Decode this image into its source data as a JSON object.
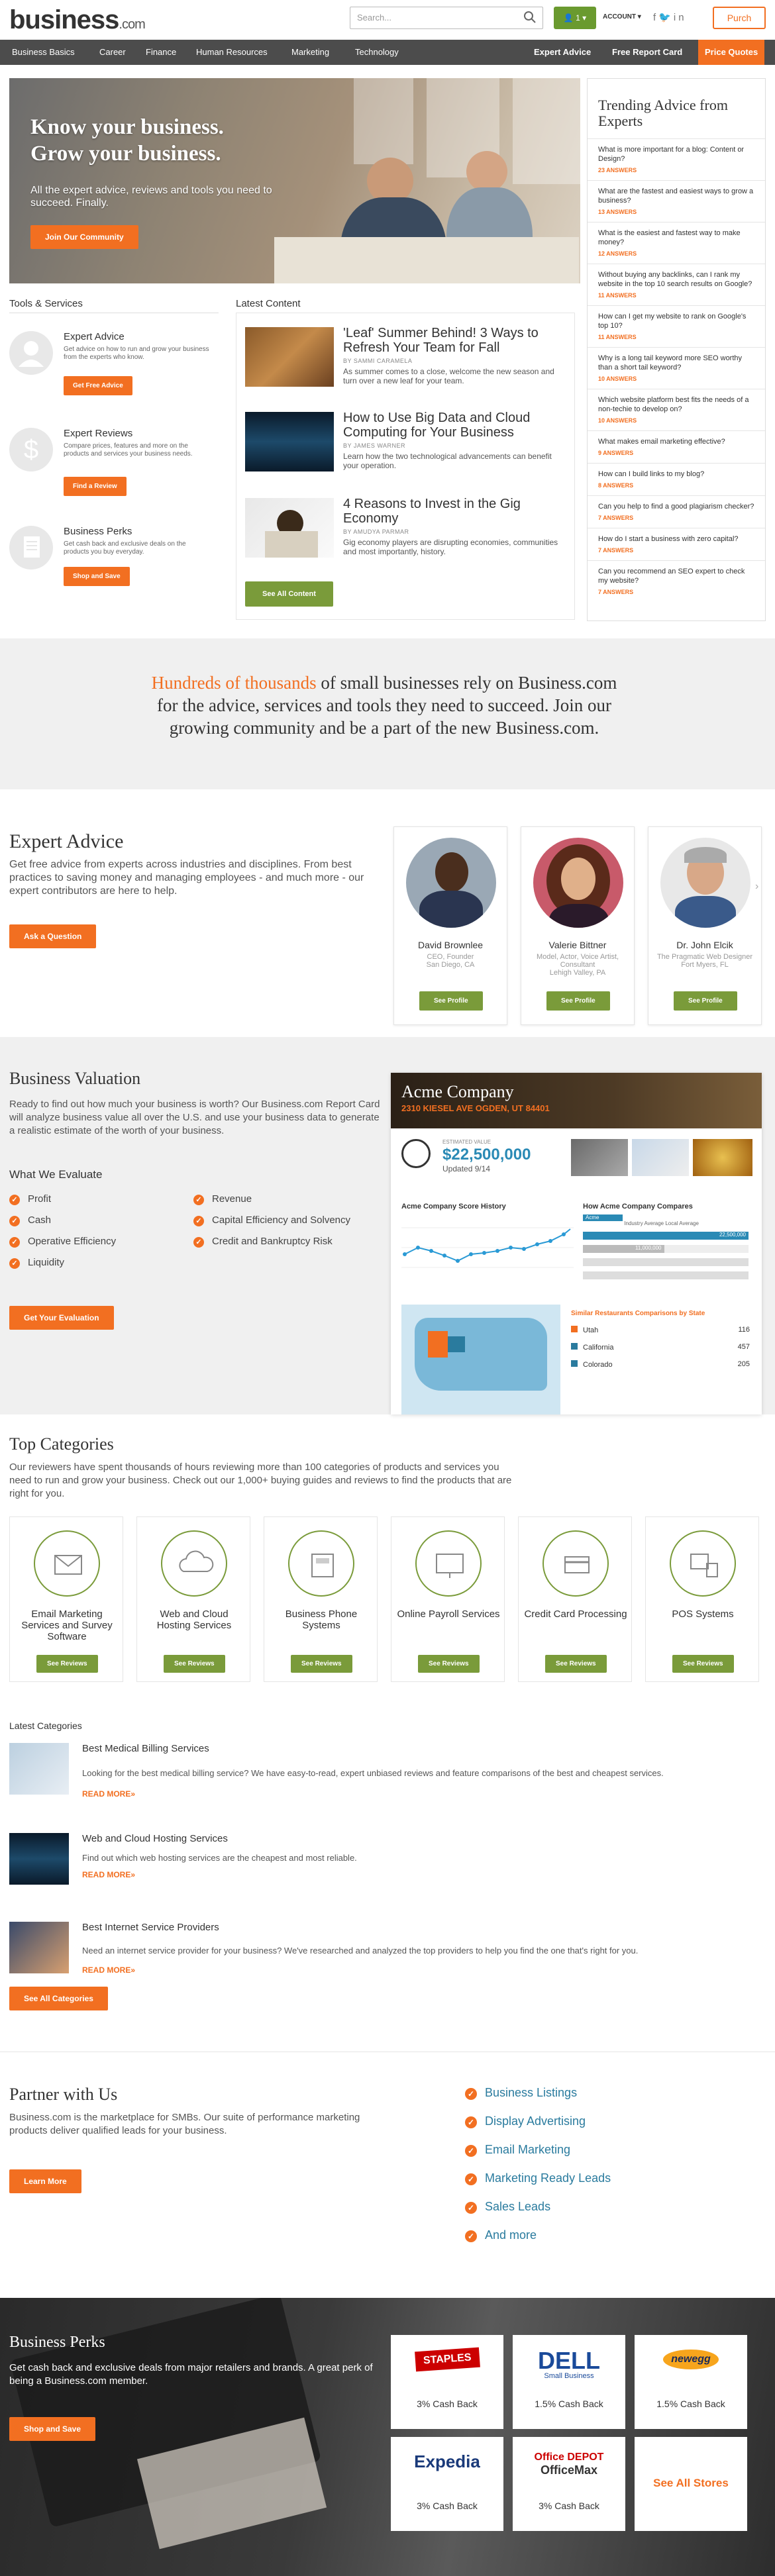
{
  "header": {
    "logo": "business",
    "logo_suffix": ".com",
    "search_placeholder": "Search...",
    "account_badge": "1",
    "account_label": "ACCOUNT",
    "purchase_label": "Purch"
  },
  "nav": {
    "left": [
      "Business Basics",
      "Career",
      "Finance",
      "Human Resources",
      "Marketing",
      "Technology"
    ],
    "right": [
      "Expert Advice",
      "Free Report Card",
      "Price Quotes"
    ]
  },
  "hero": {
    "title_l1": "Know your business.",
    "title_l2": "Grow your business.",
    "subtitle": "All the expert advice, reviews and tools you need to succeed. Finally.",
    "cta": "Join Our Community"
  },
  "trending": {
    "title": "Trending Advice from Experts",
    "items": [
      {
        "q": "What is more important for a blog: Content or Design?",
        "a": "23 ANSWERS"
      },
      {
        "q": "What are the fastest and easiest ways to grow a business?",
        "a": "13 ANSWERS"
      },
      {
        "q": "What is the easiest and fastest way to make money?",
        "a": "12 ANSWERS"
      },
      {
        "q": "Without buying any backlinks, can I rank my website in the top 10 search results on Google?",
        "a": "11 ANSWERS"
      },
      {
        "q": "How can I get my website to rank on Google's top 10?",
        "a": "11 ANSWERS"
      },
      {
        "q": "Why is a long tail keyword more SEO worthy than a short tail keyword?",
        "a": "10 ANSWERS"
      },
      {
        "q": "Which website platform best fits the needs of a non-techie to develop on?",
        "a": "10 ANSWERS"
      },
      {
        "q": "What makes email marketing effective?",
        "a": "9 ANSWERS"
      },
      {
        "q": "How can I build links to my blog?",
        "a": "8 ANSWERS"
      },
      {
        "q": "Can you help to find a good plagiarism checker?",
        "a": "7 ANSWERS"
      },
      {
        "q": "How do I start a business with zero capital?",
        "a": "7 ANSWERS"
      },
      {
        "q": "Can you recommend an SEO expert to check my website?",
        "a": "7 ANSWERS"
      }
    ]
  },
  "tools": {
    "title": "Tools & Services",
    "items": [
      {
        "t": "Expert Advice",
        "d": "Get advice on how to run and grow your business from the experts who know.",
        "b": "Get Free Advice"
      },
      {
        "t": "Expert Reviews",
        "d": "Compare prices, features and more on the products and services your business needs.",
        "b": "Find a Review"
      },
      {
        "t": "Business Perks",
        "d": "Get cash back and exclusive deals on the products you buy everyday.",
        "b": "Shop and Save"
      }
    ]
  },
  "latest": {
    "title": "Latest Content",
    "button": "See All Content",
    "items": [
      {
        "t": "'Leaf' Summer Behind! 3 Ways to Refresh Your Team for Fall",
        "by": "BY SAMMI CARAMELA",
        "d": "As summer comes to a close, welcome the new season and turn over a new leaf for your team."
      },
      {
        "t": "How to Use Big Data and Cloud Computing for Your Business",
        "by": "BY JAMES WARNER",
        "d": "Learn how the two technological advancements can benefit your operation."
      },
      {
        "t": "4 Reasons to Invest in the Gig Economy",
        "by": "BY AMUDYA PARMAR",
        "d": "Gig economy players are disrupting economies, communities and most importantly, history."
      }
    ]
  },
  "band": {
    "highlight": "Hundreds of thousands",
    "rest": " of small businesses rely on Business.com for the advice, services and tools they need to succeed. Join our growing community and be a part of the new Business.com."
  },
  "expert": {
    "title": "Expert Advice",
    "text": "Get free advice from experts across industries and disciplines. From best practices to saving money and managing employees - and much more - our expert contributors are here to help.",
    "cta": "Ask a Question",
    "people": [
      {
        "n": "David Brownlee",
        "r": "CEO, Founder\nSan Diego, CA",
        "b": "See Profile"
      },
      {
        "n": "Valerie Bittner",
        "r": "Model, Actor, Voice Artist, Consultant\nLehigh Valley, PA",
        "b": "See Profile"
      },
      {
        "n": "Dr. John Elcik",
        "r": "The Pragmatic Web Designer\nFort Myers, FL",
        "b": "See Profile"
      }
    ]
  },
  "valuation": {
    "title": "Business Valuation",
    "text": "Ready to find out how much your business is worth? Our Business.com Report Card will analyze business value all over the U.S. and use your business data to generate a realistic estimate of the worth of your business.",
    "sub": "What We Evaluate",
    "left": [
      "Profit",
      "Cash",
      "Operative Efficiency",
      "Liquidity"
    ],
    "right": [
      "Revenue",
      "Capital Efficiency and Solvency",
      "Credit and Bankruptcy Risk"
    ],
    "cta": "Get Your Evaluation",
    "dash": {
      "company": "Acme Company",
      "address": "2310 KIESEL AVE OGDEN, UT 84401",
      "est_label": "ESTIMATED VALUE",
      "value": "$22,500,000",
      "updated": "Updated 9/14",
      "hist_title": "Acme Company Score History",
      "compare_title": "How Acme Company Compares",
      "legend": [
        "Acme Company",
        "Industry Average",
        "Local Average"
      ],
      "bar_values": [
        "22,500,000",
        "11,000,000"
      ],
      "state_title": "Similar Restaurants Comparisons by State",
      "states": [
        {
          "n": "Utah",
          "v": "116"
        },
        {
          "n": "California",
          "v": "457"
        },
        {
          "n": "Colorado",
          "v": "205"
        }
      ]
    }
  },
  "categories": {
    "title": "Top Categories",
    "text": "Our reviewers have spent thousands of hours reviewing more than 100 categories of products and services you need to run and grow your business. Check out our 1,000+ buying guides and reviews to find the products that are right for you.",
    "items": [
      {
        "n": "Email Marketing Services and Survey Software",
        "b": "See Reviews",
        "icon": "envelope-icon"
      },
      {
        "n": "Web and Cloud Hosting Services",
        "b": "See Reviews",
        "icon": "cloud-icon"
      },
      {
        "n": "Business Phone Systems",
        "b": "See Reviews",
        "icon": "phone-icon"
      },
      {
        "n": "Online Payroll Services",
        "b": "See Reviews",
        "icon": "monitor-icon"
      },
      {
        "n": "Credit Card Processing",
        "b": "See Reviews",
        "icon": "card-icon"
      },
      {
        "n": "POS Systems",
        "b": "See Reviews",
        "icon": "pos-icon"
      }
    ],
    "latest_title": "Latest Categories",
    "latest": [
      {
        "t": "Best Medical Billing Services",
        "d": "Looking for the best medical billing service? We have easy-to-read, expert unbiased reviews and feature comparisons of the best and cheapest services.",
        "m": "READ MORE»"
      },
      {
        "t": "Web and Cloud Hosting Services",
        "d": "Find out which web hosting services are the cheapest and most reliable.",
        "m": "READ MORE»"
      },
      {
        "t": "Best Internet Service Providers",
        "d": "Need an internet service provider for your business? We've researched and analyzed the top providers to help you find the one that's right for you.",
        "m": "READ MORE»"
      }
    ],
    "cta": "See All Categories"
  },
  "partner": {
    "title": "Partner with Us",
    "text": "Business.com is the marketplace for SMBs. Our suite of performance marketing products deliver qualified leads for your business.",
    "cta": "Learn More",
    "links": [
      "Business Listings",
      "Display Advertising",
      "Email Marketing",
      "Marketing Ready Leads",
      "Sales Leads",
      "And more"
    ]
  },
  "perks": {
    "title": "Business Perks",
    "text": "Get cash back and exclusive deals from major retailers and brands. A great perk of being a Business.com member.",
    "cta": "Shop and Save",
    "stores": [
      {
        "n": "STAPLES",
        "c": "3% Cash Back"
      },
      {
        "n": "DELL",
        "n2": "Small Business",
        "c": "1.5% Cash Back"
      },
      {
        "n": "newegg",
        "c": "1.5% Cash Back"
      },
      {
        "n": "Expedia",
        "c": "3% Cash Back"
      },
      {
        "n": "Office DEPOT",
        "n2": "OfficeMax",
        "c": "3% Cash Back"
      }
    ],
    "all": "See All Stores"
  },
  "colors": {
    "orange": "#f26f21",
    "green": "#7a9b3a",
    "link": "#2a7b9e",
    "nav": "#4c4c4c"
  }
}
